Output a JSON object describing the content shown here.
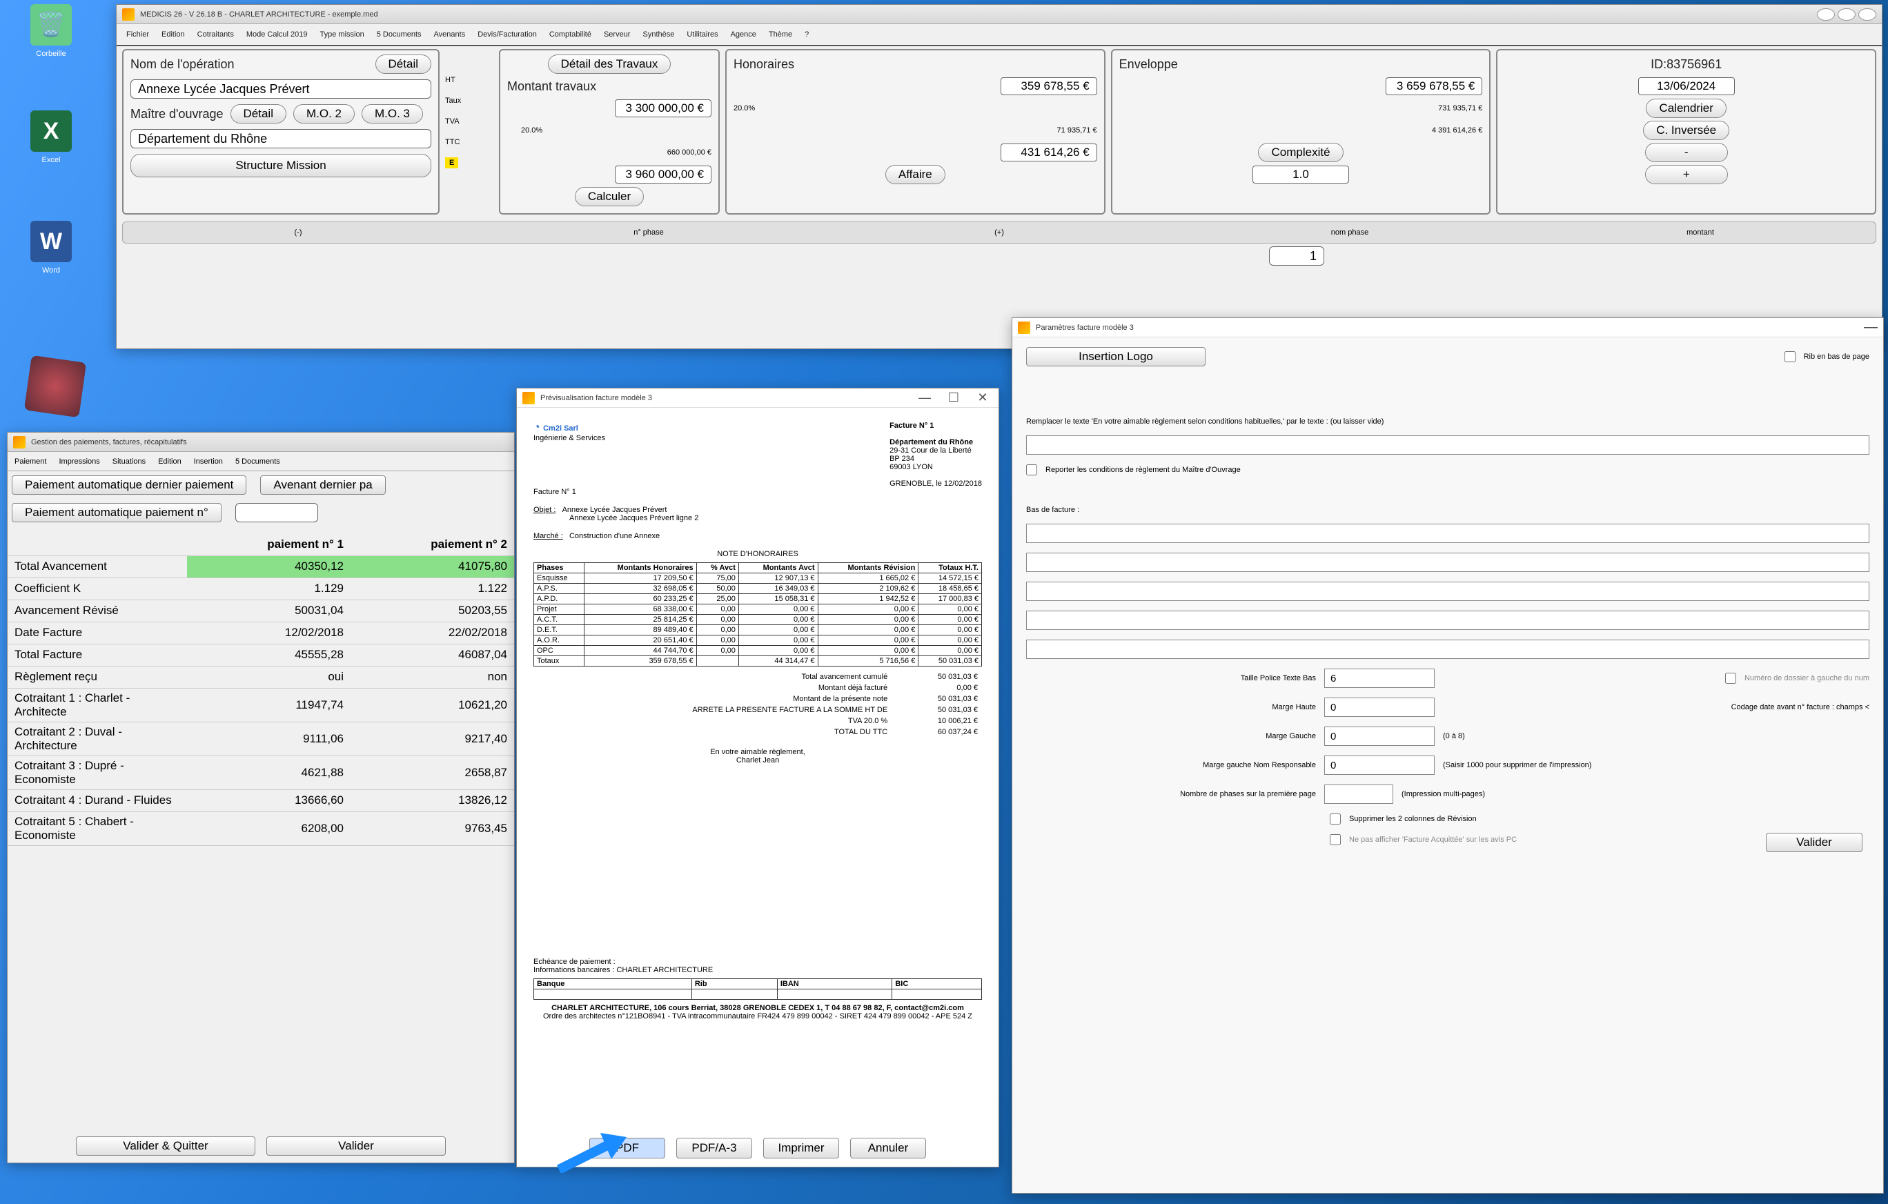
{
  "desktop": {
    "trash": "Corbeille",
    "excel": "Excel",
    "word": "Word"
  },
  "main": {
    "title": "MEDICIS 26  -  V 26.18 B - CHARLET ARCHITECTURE - exemple.med",
    "menu": [
      "Fichier",
      "Edition",
      "Cotraitants",
      "Mode Calcul 2019",
      "Type mission",
      "5 Documents",
      "Avenants",
      "Devis/Facturation",
      "Comptabilité",
      "Serveur",
      "Synthèse",
      "Utilitaires",
      "Agence",
      "Thème",
      "?"
    ],
    "nomop_label": "Nom de l'opération",
    "detail_btn": "Détail",
    "nomop": "Annexe Lycée Jacques Prévert",
    "mo_label": "Maître d'ouvrage",
    "mo2": "M.O. 2",
    "mo3": "M.O. 3",
    "mo": "Département du Rhône",
    "structure": "Structure Mission",
    "ht": "HT",
    "taux": "Taux",
    "tva": "TVA",
    "ttc": "TTC",
    "e": "E",
    "trav_btn": "Détail des Travaux",
    "trav_lbl": "Montant travaux",
    "mt_ht": "3 300 000,00 €",
    "tx": "20.0%",
    "tva_v": "660 000,00 €",
    "ttc_v": "3 960 000,00 €",
    "calc": "Calculer",
    "hono": "Honoraires",
    "hono_v": "359 678,55 €",
    "hono_pc": "20.0%",
    "hono_tva": "71 935,71 €",
    "hono_ttc": "431 614,26 €",
    "affaire": "Affaire",
    "env": "Enveloppe",
    "env_v": "3 659 678,55 €",
    "env_tva": "731 935,71 €",
    "env_ttc": "4 391 614,26 €",
    "complex": "Complexité",
    "complex_v": "1.0",
    "id": "ID:83756961",
    "date": "13/06/2024",
    "cal": "Calendrier",
    "cinv": "C. Inversée",
    "minus": "-",
    "plus": "+",
    "phase": [
      "(-)",
      "n° phase",
      "(+)",
      "nom phase",
      "montant"
    ],
    "phase_n": "1"
  },
  "gestion": {
    "title": "Gestion des paiements, factures, récapitulatifs",
    "menu": [
      "Paiement",
      "Impressions",
      "Situations",
      "Edition",
      "Insertion",
      "5 Documents"
    ],
    "b1": "Paiement automatique dernier paiement",
    "b2": "Avenant dernier pa",
    "b3": "Paiement automatique paiement n°",
    "cols": [
      "",
      "paiement n° 1",
      "paiement n° 2"
    ],
    "rows": [
      {
        "l": "Total Avancement",
        "a": "40350,12",
        "b": "41075,80",
        "hl": true
      },
      {
        "l": "Coefficient K",
        "a": "1.129",
        "b": "1.122"
      },
      {
        "l": "Avancement Révisé",
        "a": "50031,04",
        "b": "50203,55"
      },
      {
        "l": "Date Facture",
        "a": "12/02/2018",
        "b": "22/02/2018"
      },
      {
        "l": "Total Facture",
        "a": "45555,28",
        "b": "46087,04"
      },
      {
        "l": "Règlement reçu",
        "a": "oui",
        "b": "non"
      },
      {
        "l": "Cotraitant 1 : Charlet - Architecte",
        "a": "11947,74",
        "b": "10621,20"
      },
      {
        "l": "Cotraitant 2 : Duval - Architecture",
        "a": "9111,06",
        "b": "9217,40"
      },
      {
        "l": "Cotraitant 3 : Dupré - Economiste",
        "a": "4621,88",
        "b": "2658,87"
      },
      {
        "l": "Cotraitant 4 : Durand - Fluides",
        "a": "13666,60",
        "b": "13826,12"
      },
      {
        "l": "Cotraitant 5 : Chabert - Economiste",
        "a": "6208,00",
        "b": "9763,45"
      }
    ],
    "vq": "Valider & Quitter",
    "v": "Valider"
  },
  "preview": {
    "title": "Prévisualisation facture modèle 3",
    "company": "Cm2i Sarl",
    "fact": "Facture N° 1",
    "dept": "Département du Rhône",
    "addr1": "29-31 Cour de la Liberté",
    "addr2": "BP 234",
    "addr3": "69003   LYON",
    "place": "GRENOBLE, le 12/02/2018",
    "fact2": "Facture N° 1",
    "objet": "Objet :",
    "objv1": "Annexe Lycée Jacques Prévert",
    "objv2": "Annexe Lycée Jacques Prévert ligne 2",
    "marche": "Marché :",
    "marchev": "Construction d'une Annexe",
    "note": "NOTE D'HONORAIRES",
    "thead": [
      "Phases",
      "Montants Honoraires",
      "% Avct",
      "Montants Avct",
      "Montants Révision",
      "Totaux H.T."
    ],
    "lines": [
      [
        "Esquisse",
        "17 209,50 €",
        "75,00",
        "12 907,13 €",
        "1 665,02 €",
        "14 572,15 €"
      ],
      [
        "A.P.S.",
        "32 698,05 €",
        "50,00",
        "16 349,03 €",
        "2 109,62 €",
        "18 458,65 €"
      ],
      [
        "A.P.D.",
        "60 233,25 €",
        "25,00",
        "15 058,31 €",
        "1 942,52 €",
        "17 000,83 €"
      ],
      [
        "Projet",
        "68 338,00 €",
        "0,00",
        "0,00 €",
        "0,00 €",
        "0,00 €"
      ],
      [
        "A.C.T.",
        "25 814,25 €",
        "0,00",
        "0,00 €",
        "0,00 €",
        "0,00 €"
      ],
      [
        "D.E.T.",
        "89 489,40 €",
        "0,00",
        "0,00 €",
        "0,00 €",
        "0,00 €"
      ],
      [
        "A.O.R.",
        "20 651,40 €",
        "0,00",
        "0,00 €",
        "0,00 €",
        "0,00 €"
      ],
      [
        "OPC",
        "44 744,70 €",
        "0,00",
        "0,00 €",
        "0,00 €",
        "0,00 €"
      ]
    ],
    "tot": [
      "Totaux",
      "359 678,55 €",
      "",
      "44 314,47 €",
      "5 716,56 €",
      "50 031,03 €"
    ],
    "sums": [
      [
        "Total avancement cumulé",
        "50 031,03 €"
      ],
      [
        "Montant déjà facturé",
        "0,00 €"
      ],
      [
        "Montant de la présente note",
        "50 031,03 €"
      ],
      [
        "ARRETE LA PRESENTE FACTURE A LA SOMME HT DE",
        "50 031,03 €"
      ],
      [
        "TVA 20.0 %",
        "10 006,21 €"
      ],
      [
        "TOTAL DU TTC",
        "60 037,24 €"
      ]
    ],
    "sign1": "En votre aimable règlement,",
    "sign2": "Charlet Jean",
    "ech": "Echéance de paiement :",
    "info": "Informations bancaires :  CHARLET ARCHITECTURE",
    "bank": [
      "Banque",
      "Rib",
      "IBAN",
      "BIC"
    ],
    "foot1": "CHARLET ARCHITECTURE, 106 cours Berriat, 38028 GRENOBLE CEDEX 1, T 04 88 67 98 82, F, contact@cm2i.com",
    "foot2": "Ordre des architectes n°121BO8941 -  TVA intracommunautaire FR424 479 899 00042 - SIRET 424 479 899 00042 - APE 524 Z",
    "pdf": "PDF",
    "pdfa": "PDF/A-3",
    "imp": "Imprimer",
    "ann": "Annuler"
  },
  "params": {
    "title": "Paramètres facture modèle 3",
    "ins": "Insertion Logo",
    "rib": "Rib en bas de page",
    "replace": "Remplacer le texte 'En votre aimable règlement selon conditions habituelles,' par le texte :   (ou laisser vide)",
    "report": "Reporter les conditions de règlement du Maître d'Ouvrage",
    "bas": "Bas de facture :",
    "taille_l": "Taille Police Texte Bas",
    "taille_v": "6",
    "num": "Numéro de dossier à gauche du num",
    "mh_l": "Marge Haute",
    "mh_v": "0",
    "codage": "Codage date avant n° facture : champs <",
    "mg_l": "Marge Gauche",
    "mg_v": "0",
    "mg_hint": "(0 à 8)",
    "mgr_l": "Marge gauche Nom Responsable",
    "mgr_v": "0",
    "mgr_hint": "(Saisir 1000 pour supprimer de l'impression)",
    "nph_l": "Nombre de phases sur la première page",
    "nph_hint": "(Impression multi-pages)",
    "sup": "Supprimer les 2 colonnes de Révision",
    "nepas": "Ne pas afficher 'Facture Acquittée' sur les avis PC",
    "valider": "Valider"
  }
}
